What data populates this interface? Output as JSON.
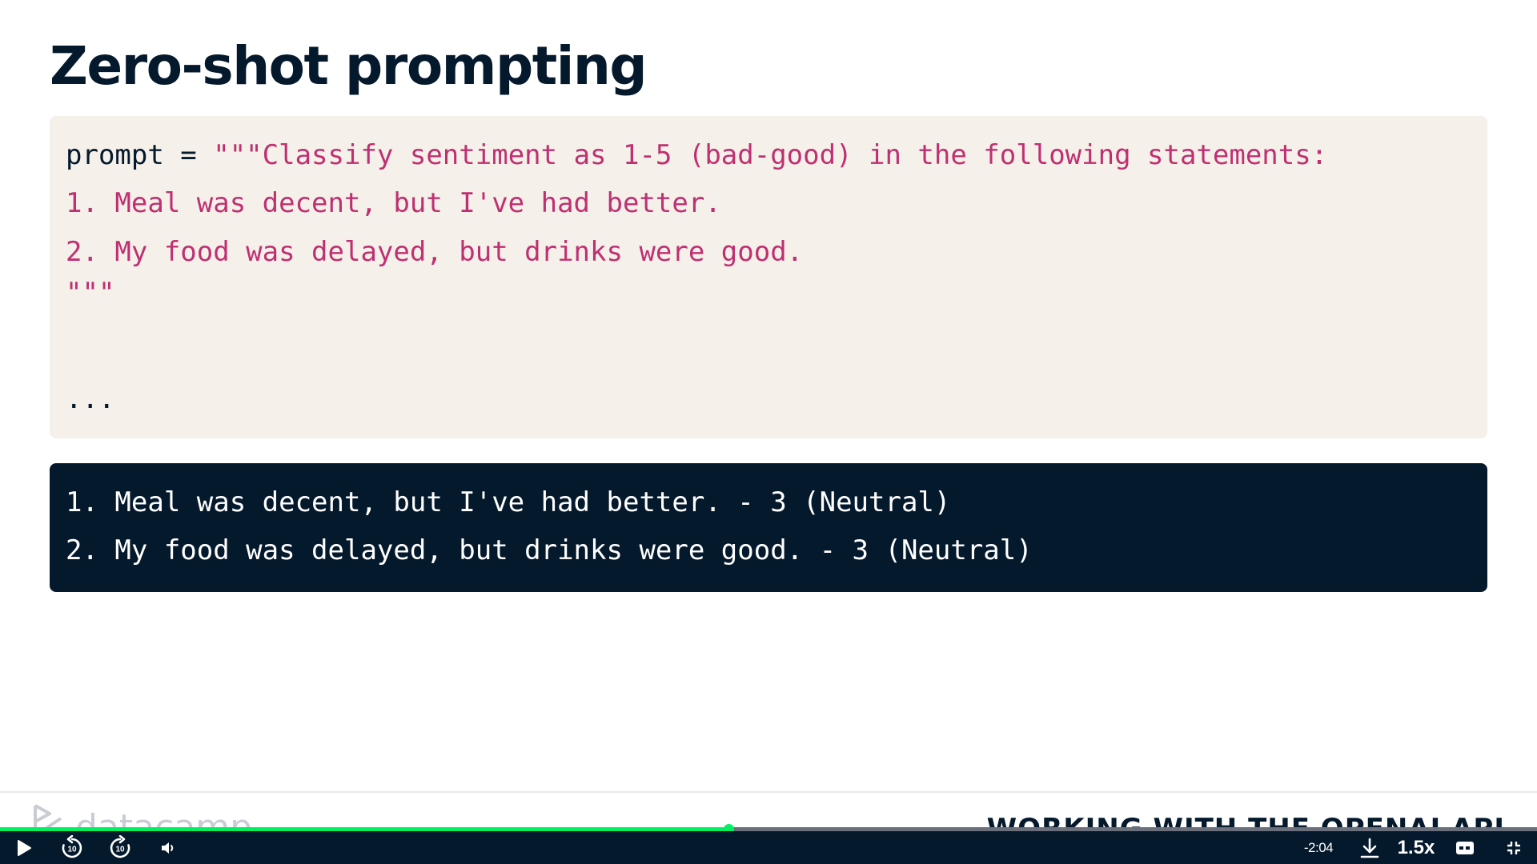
{
  "slide": {
    "title": "Zero-shot prompting"
  },
  "code": {
    "line1_prefix": "prompt = ",
    "line1_string": "\"\"\"Classify sentiment as 1-5 (bad-good) in the following statements:",
    "line2": "1. Meal was decent, but I've had better.",
    "line3": "2. My food was delayed, but drinks were good.",
    "line4": "\"\"\"",
    "line6": "..."
  },
  "output": {
    "lines": [
      "1. Meal was decent, but I've had better. - 3 (Neutral)",
      "2. My food was delayed, but drinks were good. - 3 (Neutral)"
    ]
  },
  "footer": {
    "logo_text": "datacamp",
    "course_title": "WORKING WITH THE OPENAI API"
  },
  "player": {
    "progress_fraction": 0.474,
    "time_remaining": "-2:04",
    "speed": "1.5x",
    "rewind_label": "10",
    "forward_label": "10",
    "icons": {
      "play": "play-icon",
      "rewind": "rewind-10-icon",
      "forward": "forward-10-icon",
      "volume": "volume-icon",
      "download": "download-icon",
      "captions": "captions-icon",
      "fullscreen": "exit-fullscreen-icon"
    }
  },
  "colors": {
    "navy": "#05192d",
    "code_bg": "#f5f0e9",
    "string": "#bf3072",
    "progress": "#03ef62"
  }
}
